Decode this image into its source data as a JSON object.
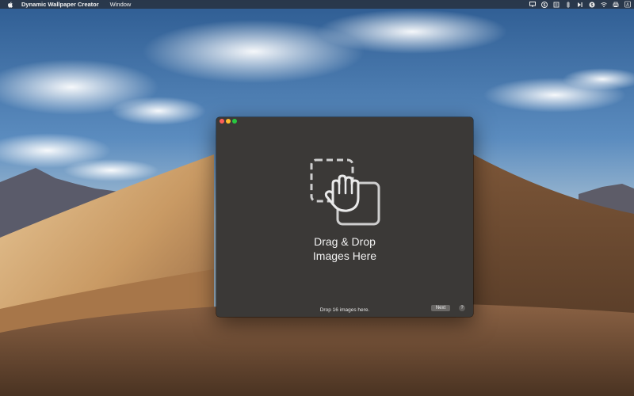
{
  "menubar": {
    "apple_icon": "apple-icon",
    "app_name": "Dynamic Wallpaper Creator",
    "items": [
      "Window"
    ],
    "status_icons": [
      "display-icon",
      "skype-icon",
      "list-icon",
      "align-icon",
      "play-icon",
      "skype-icon",
      "wifi-icon",
      "printer-icon",
      "keyboard-icon"
    ],
    "keyboard_letter": "A"
  },
  "window": {
    "drop_title_line1": "Drag & Drop",
    "drop_title_line2": "Images Here",
    "drop_hint": "Drop 16 images here.",
    "next_label": "Next",
    "help_label": "?"
  },
  "colors": {
    "window_bg": "#3b3937",
    "close": "#fe5f57",
    "minimize": "#febc2e",
    "maximize": "#28c840"
  }
}
